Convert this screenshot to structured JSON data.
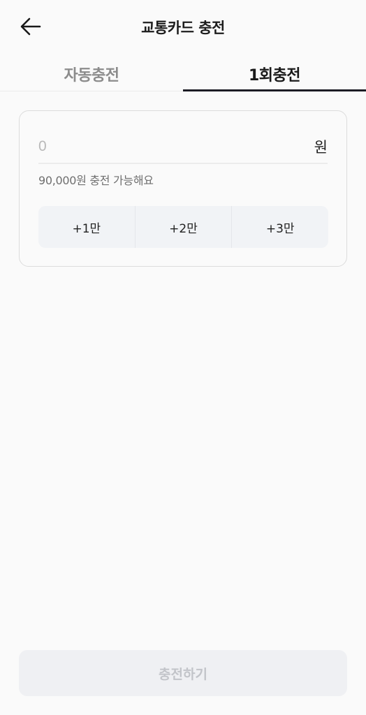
{
  "header": {
    "title": "교통카드 충전",
    "back_icon": "arrow-left-icon"
  },
  "tabs": [
    {
      "label": "자동충전",
      "active": false
    },
    {
      "label": "1회충전",
      "active": true
    }
  ],
  "charge": {
    "amount_placeholder": "0",
    "amount_value": "",
    "unit": "원",
    "hint": "90,000원 충전 가능해요",
    "quick_buttons": [
      {
        "label": "+1만"
      },
      {
        "label": "+2만"
      },
      {
        "label": "+3만"
      }
    ]
  },
  "footer": {
    "submit_label": "충전하기",
    "submit_enabled": false
  },
  "colors": {
    "background": "#fafafa",
    "active_tab_underline": "#1c1c24",
    "quick_button_bg": "#f1f3f6",
    "disabled_button_bg": "#eff0f3",
    "disabled_button_text": "#c2c4c9"
  }
}
